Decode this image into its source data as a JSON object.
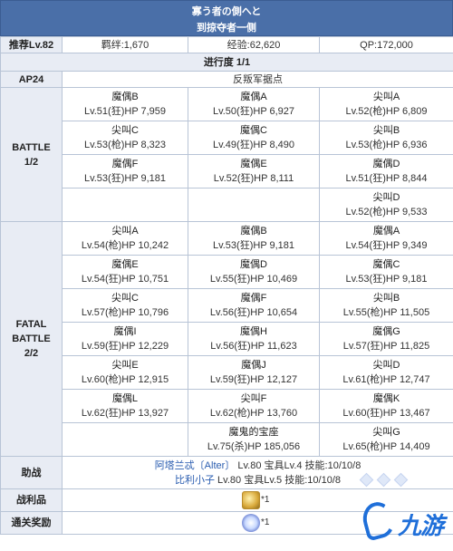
{
  "header": {
    "title_line1": "寡う者の側へと",
    "title_line2": "到掠夺者一侧"
  },
  "summary": {
    "recommended": "推荐Lv.82",
    "bond": "羁绊:1,670",
    "exp": "经验:62,620",
    "qp": "QP:172,000"
  },
  "progress": "进行度 1/1",
  "ap": {
    "label": "AP24",
    "value": "反叛军据点"
  },
  "battle1": {
    "label_line1": "BATTLE",
    "label_line2": "1/2",
    "rows": [
      [
        {
          "name": "魔偶B",
          "stat": "Lv.51(狂)HP 7,959"
        },
        {
          "name": "魔偶A",
          "stat": "Lv.50(狂)HP 6,927"
        },
        {
          "name": "尖叫A",
          "stat": "Lv.52(枪)HP 6,809"
        }
      ],
      [
        {
          "name": "尖叫C",
          "stat": "Lv.53(枪)HP 8,323"
        },
        {
          "name": "魔偶C",
          "stat": "Lv.49(狂)HP 8,490"
        },
        {
          "name": "尖叫B",
          "stat": "Lv.53(枪)HP 6,936"
        }
      ],
      [
        {
          "name": "魔偶F",
          "stat": "Lv.53(狂)HP 9,181"
        },
        {
          "name": "魔偶E",
          "stat": "Lv.52(狂)HP 8,111"
        },
        {
          "name": "魔偶D",
          "stat": "Lv.51(狂)HP 8,844"
        }
      ],
      [
        {
          "name": "",
          "stat": ""
        },
        {
          "name": "",
          "stat": ""
        },
        {
          "name": "尖叫D",
          "stat": "Lv.52(枪)HP 9,533"
        }
      ]
    ]
  },
  "battle2": {
    "label_line1": "FATAL",
    "label_line2": "BATTLE",
    "label_line3": "2/2",
    "rows": [
      [
        {
          "name": "尖叫A",
          "stat": "Lv.54(枪)HP 10,242"
        },
        {
          "name": "魔偶B",
          "stat": "Lv.53(狂)HP 9,181"
        },
        {
          "name": "魔偶A",
          "stat": "Lv.54(狂)HP 9,349"
        }
      ],
      [
        {
          "name": "魔偶E",
          "stat": "Lv.54(狂)HP 10,751"
        },
        {
          "name": "魔偶D",
          "stat": "Lv.55(狂)HP 10,469"
        },
        {
          "name": "魔偶C",
          "stat": "Lv.53(狂)HP 9,181"
        }
      ],
      [
        {
          "name": "尖叫C",
          "stat": "Lv.57(枪)HP 10,796"
        },
        {
          "name": "魔偶F",
          "stat": "Lv.56(狂)HP 10,654"
        },
        {
          "name": "尖叫B",
          "stat": "Lv.55(枪)HP 11,505"
        }
      ],
      [
        {
          "name": "魔偶I",
          "stat": "Lv.59(狂)HP 12,229"
        },
        {
          "name": "魔偶H",
          "stat": "Lv.56(狂)HP 11,623"
        },
        {
          "name": "魔偶G",
          "stat": "Lv.57(狂)HP 11,825"
        }
      ],
      [
        {
          "name": "尖叫E",
          "stat": "Lv.60(枪)HP 12,915"
        },
        {
          "name": "魔偶J",
          "stat": "Lv.59(狂)HP 12,127"
        },
        {
          "name": "尖叫D",
          "stat": "Lv.61(枪)HP 12,747"
        }
      ],
      [
        {
          "name": "魔偶L",
          "stat": "Lv.62(狂)HP 13,927"
        },
        {
          "name": "尖叫F",
          "stat": "Lv.62(枪)HP 13,760"
        },
        {
          "name": "魔偶K",
          "stat": "Lv.60(狂)HP 13,467"
        }
      ],
      [
        {
          "name": "",
          "stat": ""
        },
        {
          "name": "魔鬼的宝座",
          "stat": "Lv.75(杀)HP 185,056"
        },
        {
          "name": "尖叫G",
          "stat": "Lv.65(枪)HP 14,409"
        }
      ]
    ]
  },
  "support": {
    "label": "助战",
    "line1_name": "阿塔兰忒〔Alter〕",
    "line1_rest": " Lv.80 宝具Lv.4 技能:10/10/8",
    "line2_name": "比利小子",
    "line2_rest": " Lv.80 宝具Lv.5 技能:10/10/8"
  },
  "drops": {
    "label": "战利品",
    "icon": "gold-material-icon",
    "count": "*1"
  },
  "clear": {
    "label": "通关奖励",
    "icon": "star-quartz-icon",
    "count": "*1"
  },
  "watermark": {
    "text": "九游"
  },
  "colors": {
    "header_bg": "#4a6fa8",
    "cell_header": "#e8ecf4",
    "border": "#b8c4d6",
    "link": "#2a5db0",
    "watermark": "#1f6fd9"
  }
}
